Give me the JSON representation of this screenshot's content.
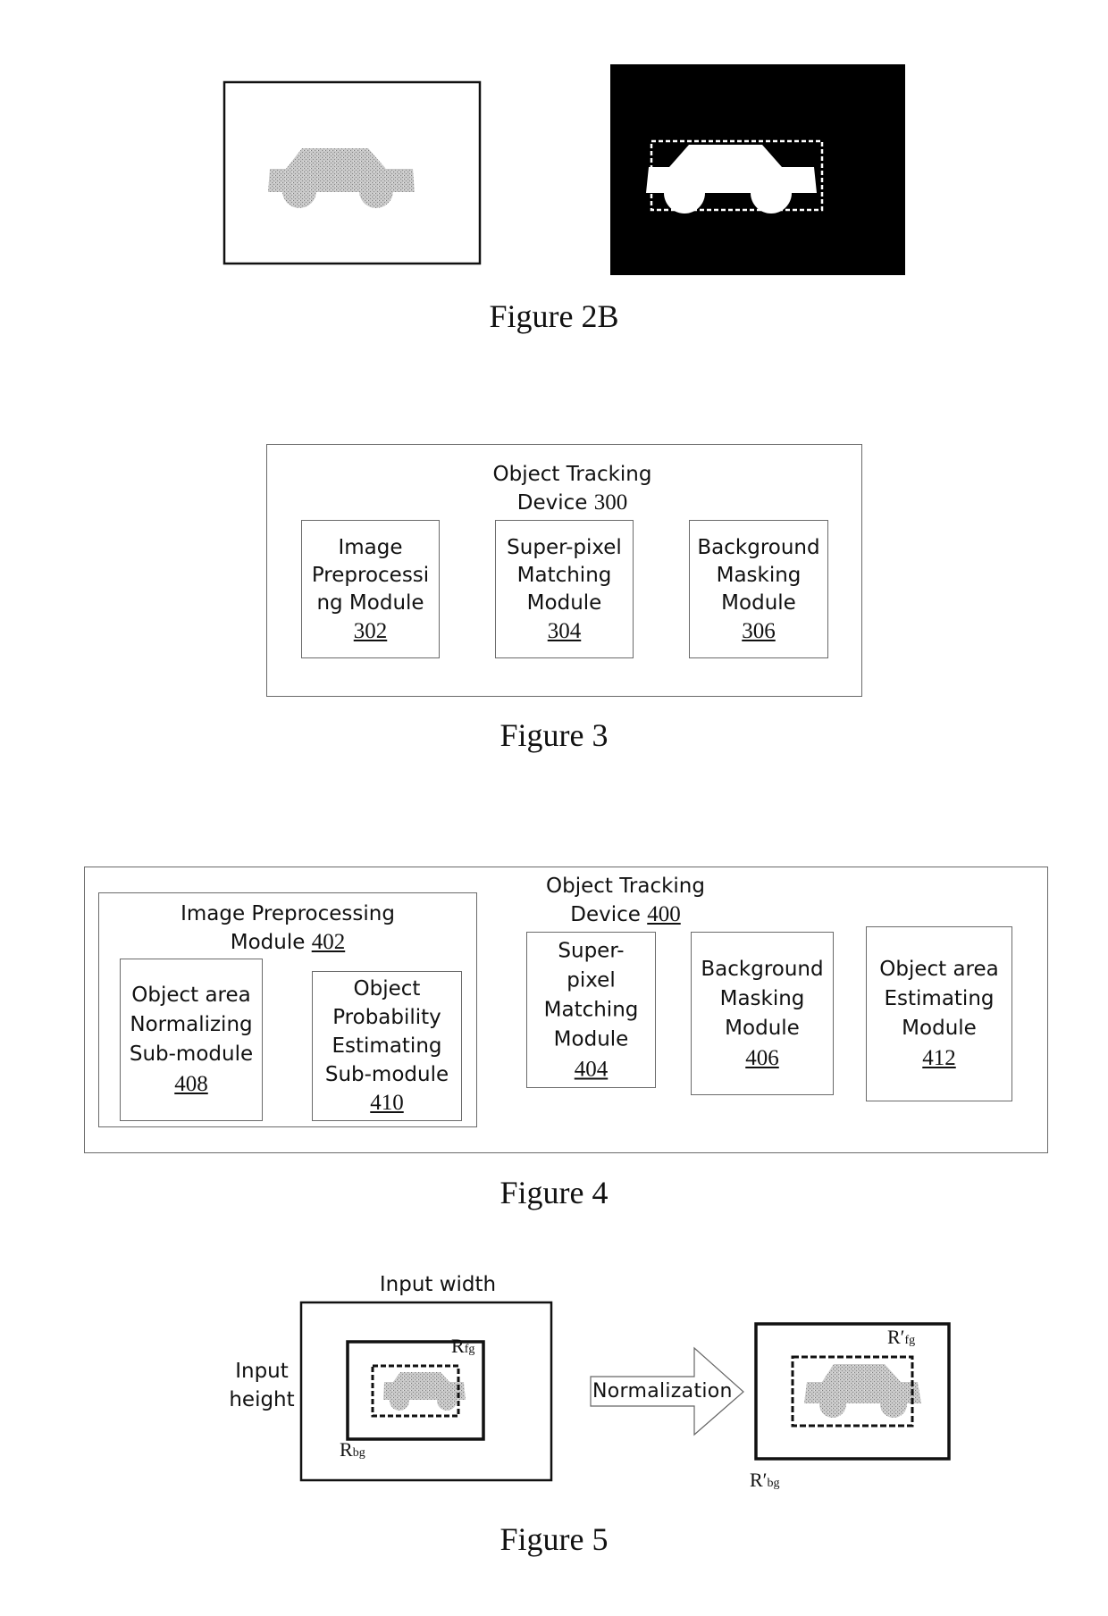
{
  "figure_2b": {
    "caption": "Figure 2B",
    "left_panel": "gray-car-on-white",
    "right_panel": "white-car-mask-on-black-with-dashed-box"
  },
  "figure_3": {
    "caption": "Figure 3",
    "device_title_line1": "Object Tracking",
    "device_title_line2": "Device",
    "device_ref": "300",
    "modules": [
      {
        "lines": [
          "Image",
          "Preprocessi",
          "ng Module"
        ],
        "ref": "302"
      },
      {
        "lines": [
          "Super-pixel",
          "Matching",
          "Module"
        ],
        "ref": "304"
      },
      {
        "lines": [
          "Background",
          "Masking",
          "Module"
        ],
        "ref": "306"
      }
    ]
  },
  "figure_4": {
    "caption": "Figure 4",
    "device_title_line1": "Object Tracking",
    "device_title_line2": "Device",
    "device_ref": "400",
    "preprocessing_title_line1": "Image Preprocessing",
    "preprocessing_title_line2": "Module",
    "preprocessing_ref": "402",
    "submodules": [
      {
        "lines": [
          "Object area",
          "Normalizing",
          "Sub-module"
        ],
        "ref": "408"
      },
      {
        "lines": [
          "Object",
          "Probability",
          "Estimating",
          "Sub-module"
        ],
        "ref": "410"
      }
    ],
    "modules": [
      {
        "lines": [
          "Super-",
          "pixel",
          "Matching",
          "Module"
        ],
        "ref": "404"
      },
      {
        "lines": [
          "Background",
          "Masking",
          "Module"
        ],
        "ref": "406"
      },
      {
        "lines": [
          "Object area",
          "Estimating",
          "Module"
        ],
        "ref": "412"
      }
    ]
  },
  "figure_5": {
    "caption": "Figure 5",
    "input_width_label": "Input width",
    "input_height_line1": "Input",
    "input_height_line2": "height",
    "r_fg": {
      "base": "R",
      "sub": "fg"
    },
    "r_bg": {
      "base": "R",
      "sub": "bg"
    },
    "r_prime_fg": {
      "base": "R′",
      "sub": "fg"
    },
    "r_prime_bg": {
      "base": "R′",
      "sub": "bg"
    },
    "arrow_label": "Normalization"
  }
}
